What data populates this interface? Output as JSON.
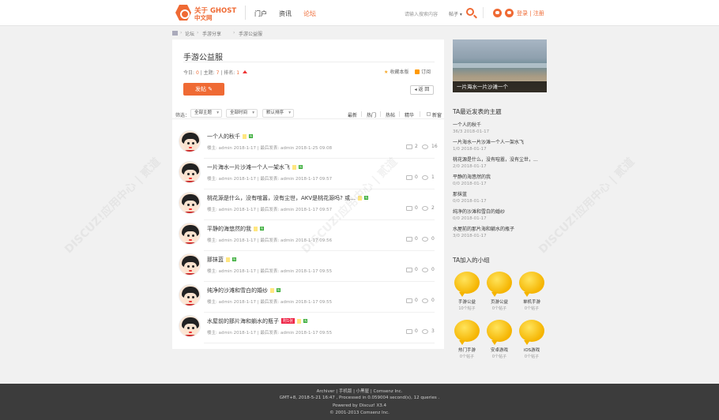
{
  "header": {
    "logo_line1": "关于 GHOST",
    "logo_line2": "中文网",
    "nav": [
      "门户",
      "资讯",
      "论坛"
    ],
    "search_placeholder": "请输入搜索内容",
    "search_type": "帖子 ▾",
    "login_text": "登录 | 注册"
  },
  "breadcrumb": [
    "论坛",
    "手游分享",
    "手游公益服"
  ],
  "forum": {
    "title": "手游公益服",
    "stats_today_label": "今日:",
    "stats_today": "0",
    "stats_topics_label": "主题:",
    "stats_topics": "7",
    "stats_rank_label": "排名:",
    "stats_rank": "1",
    "fav_label": "收藏本版",
    "rss_label": "订阅",
    "post_button": "发帖 ✎",
    "back_button": "◂ 返 回"
  },
  "filter": {
    "label": "筛选：",
    "select1": "全部主题",
    "select2": "全部时间",
    "select3": "默认排序",
    "links": [
      "最新",
      "热门",
      "热帖",
      "精华"
    ],
    "new_window": "新窗"
  },
  "threads": [
    {
      "title": "一个人的秋千",
      "author": "楼主: admin 2018-1-17",
      "last": "最后发表: admin 2018-1-25 09:08",
      "replies": "2",
      "views": "16",
      "pic": false
    },
    {
      "title": "一片海水一片沙滩一个人一架水飞",
      "author": "楼主: admin 2018-1-17",
      "last": "最后发表: admin 2018-1-17 09:57",
      "replies": "0",
      "views": "1",
      "pic": false
    },
    {
      "title": "桃花源是什么，没有喧嚣，没有尘世，AKV是桃花源吗? 或…",
      "author": "楼主: admin 2018-1-17",
      "last": "最后发表: admin 2018-1-17 09:57",
      "replies": "0",
      "views": "2",
      "pic": false
    },
    {
      "title": "平静的海悠然的我",
      "author": "楼主: admin 2018-1-17",
      "last": "最后发表: admin 2018-1-17 09:56",
      "replies": "0",
      "views": "0",
      "pic": false
    },
    {
      "title": "那抹蓝",
      "author": "楼主: admin 2018-1-17",
      "last": "最后发表: admin 2018-1-17 09:55",
      "replies": "0",
      "views": "0",
      "pic": false
    },
    {
      "title": "纯净的沙滩和雪白的婚纱",
      "author": "楼主: admin 2018-1-17",
      "last": "最后发表: admin 2018-1-17 09:55",
      "replies": "0",
      "views": "0",
      "pic": false
    },
    {
      "title": "水屋前的那片海和躺水的瓶子",
      "author": "楼主: admin 2018-1-17",
      "last": "最后发表: admin 2018-1-17 09:55",
      "replies": "0",
      "views": "3",
      "pic": true,
      "pic_label": "附1张"
    }
  ],
  "sidebar": {
    "image_caption": "一片海水一片沙滩一个",
    "recent_title": "TA最近发表的主题",
    "recent": [
      {
        "title": "一个人的秋千",
        "date": "36/3 2018-01-17"
      },
      {
        "title": "一片海水一片沙滩一个人一架水飞",
        "date": "1/0 2018-01-17"
      },
      {
        "title": "桃花源是什么，没有喧嚣，没有尘世，...",
        "date": "2/0 2018-01-17"
      },
      {
        "title": "平静的海悠然的我",
        "date": "0/0 2018-01-17"
      },
      {
        "title": "那抹蓝",
        "date": "0/0 2018-01-17"
      },
      {
        "title": "纯净的沙滩和雪白的婚纱",
        "date": "0/0 2018-01-17"
      },
      {
        "title": "水屋前的那片海和躺水的瓶子",
        "date": "3/0 2018-01-17"
      }
    ],
    "groups_title": "TA加入的小组",
    "groups": [
      {
        "name": "手游公益",
        "count": "10个帖子"
      },
      {
        "name": "页游公益",
        "count": "0个帖子"
      },
      {
        "name": "单机手游",
        "count": "0个帖子"
      },
      {
        "name": "热门手游",
        "count": "0个帖子"
      },
      {
        "name": "安卓游戏",
        "count": "0个帖子"
      },
      {
        "name": "iOS游戏",
        "count": "0个帖子"
      }
    ]
  },
  "footer": {
    "line1": "Archiver | 手机版 | 小黑屋 | Comsenz Inc.",
    "line2": "GMT+8, 2018-5-21 16:47 , Processed in 0.059004 second(s), 12 queries .",
    "line3": "Powered by Discuz! X3.4",
    "line4": "© 2001-2013 Comsenz Inc."
  },
  "colors": {
    "accent": "#ef6a34",
    "footer_bg": "#3c3c3c",
    "page_bg": "#f1f1f1"
  }
}
